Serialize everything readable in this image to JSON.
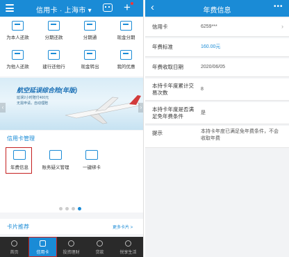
{
  "left": {
    "header": {
      "title": "信用卡 · 上海市 ▾"
    },
    "quick_actions": [
      {
        "label": "为本人还款"
      },
      {
        "label": "分期还款"
      },
      {
        "label": "分期通"
      },
      {
        "label": "现金分期"
      },
      {
        "label": "为他人还款"
      },
      {
        "label": "建行还他行"
      },
      {
        "label": "现金转出"
      },
      {
        "label": "我的优惠"
      }
    ],
    "banner": {
      "title": "航空延误综合险(年版)",
      "line1": "延误2小时赔付400元",
      "line2": "无需申请，自动理赔"
    },
    "card_management": {
      "heading": "信用卡管理",
      "items": [
        {
          "label": "年费信息"
        },
        {
          "label": "账务疑义管理"
        },
        {
          "label": "一键绑卡"
        }
      ]
    },
    "recommend": {
      "heading": "卡片推荐",
      "more": "更多卡片 >"
    },
    "tabbar": [
      {
        "label": "首页"
      },
      {
        "label": "信用卡"
      },
      {
        "label": "投资理财"
      },
      {
        "label": "贷款"
      },
      {
        "label": "悦享生活"
      }
    ]
  },
  "right": {
    "header": {
      "title": "年费信息",
      "more": "•••"
    },
    "rows": [
      {
        "key": "信用卡",
        "value": "6259***"
      },
      {
        "key": "年费标准",
        "value": "160.00元"
      },
      {
        "key": "年费收取日期",
        "value": "2020/06/05"
      },
      {
        "key": "本持卡年度累计交易次数",
        "value": "8"
      },
      {
        "key": "本持卡年度是否满足免年费条件",
        "value": "是"
      },
      {
        "key": "提示",
        "value": "本持卡年度已满足免年费条件，不会收取年费"
      }
    ]
  },
  "colors": {
    "accent": "#1a8bd6",
    "highlight": "#c41f1f",
    "tabbar": "#2a2a2a"
  }
}
